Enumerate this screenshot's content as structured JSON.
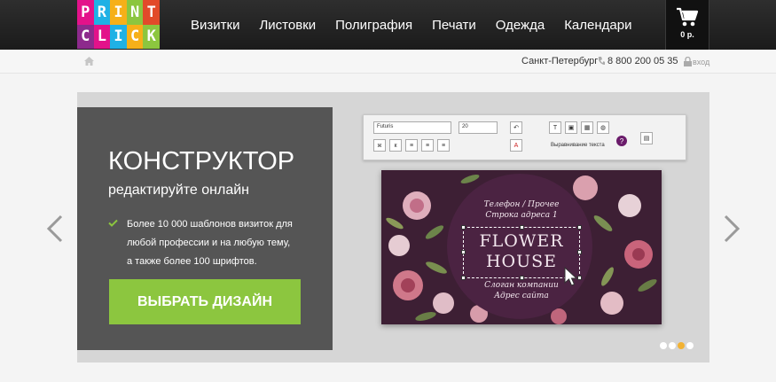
{
  "logo": {
    "letters": [
      "P",
      "R",
      "I",
      "N",
      "T",
      "C",
      "L",
      "I",
      "C",
      "K"
    ],
    "colors": [
      "#e3128a",
      "#1fb1e5",
      "#f6b019",
      "#8cc63f",
      "#e24a2a",
      "#8d2a8c",
      "#e3128a",
      "#1fb1e5",
      "#f6b019",
      "#8cc63f"
    ]
  },
  "nav": {
    "items": [
      "Визитки",
      "Листовки",
      "Полиграфия",
      "Печати",
      "Одежда",
      "Календари"
    ]
  },
  "cart": {
    "total": "0 р.",
    "icon": "cart-icon"
  },
  "infobar": {
    "city": "Санкт-Петербург",
    "phone": "8 800 200 05 35",
    "login": "вход"
  },
  "promo": {
    "title": "КОНСТРУКТОР",
    "subtitle": "редактируйте онлайн",
    "text": "Более 10 000 шаблонов визиток для любой профессии и на любую тему, а также более 100 шрифтов.",
    "cta": "ВЫБРАТЬ ДИЗАЙН",
    "accent": "#8cc63f"
  },
  "editor": {
    "font": "Futuris",
    "size": "20",
    "align_label": "Выравнивание текста"
  },
  "card": {
    "line1": "Телефон / Прочее",
    "line2": "Строка адреса 1",
    "brand1": "FLOWER",
    "brand2": "HOUSE",
    "slogan": "Слоган компании",
    "site": "Адрес сайта"
  },
  "slider": {
    "slide_count": 4,
    "active_slide": 3
  }
}
